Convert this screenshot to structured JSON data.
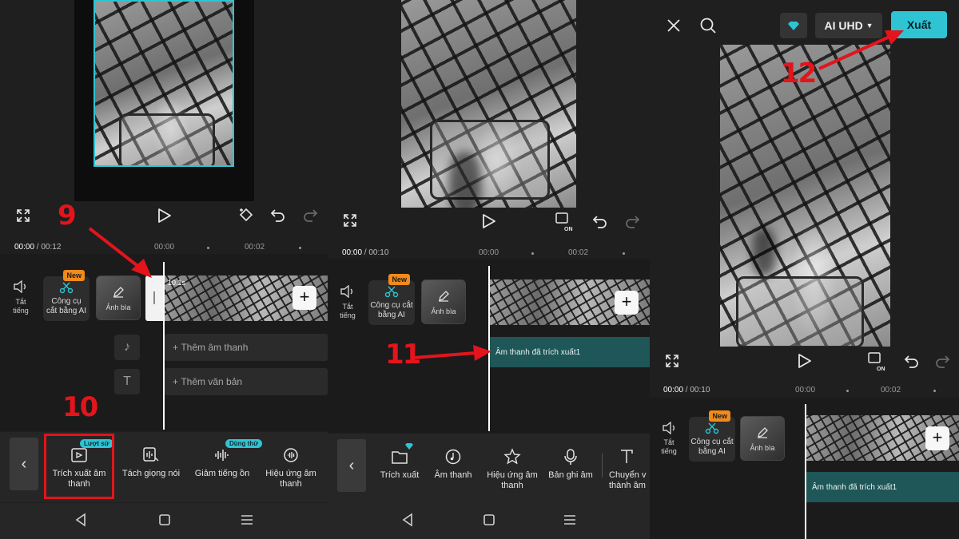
{
  "steps": {
    "s9": "9",
    "s10": "10",
    "s11": "11",
    "s12": "12"
  },
  "panel1": {
    "time_current": "00:00",
    "time_total": " / 00:12",
    "ticks": [
      "00:00",
      "00:02"
    ],
    "mute_label_1": "Tắt",
    "mute_label_2": "tiếng",
    "ai_tool_badge": "New",
    "ai_tool_label_1": "Công cụ",
    "ai_tool_label_2": "cắt bằng AI",
    "cover_label": "Ảnh bìa",
    "clip_duration": "10.1s",
    "add_audio": "Thêm âm thanh",
    "add_text": "Thêm văn bản",
    "tools": [
      {
        "label_1": "Trích xuất âm",
        "label_2": "thanh",
        "badge": "Lượt sử"
      },
      {
        "label_1": "Tách giọng nói",
        "label_2": ""
      },
      {
        "label_1": "Giảm tiếng ồn",
        "label_2": "",
        "badge": "Dùng thử"
      },
      {
        "label_1": "Hiệu ứng âm",
        "label_2": "thanh"
      }
    ]
  },
  "panel2": {
    "time_current": "00:00",
    "time_total": " / 00:10",
    "ticks": [
      "00:00",
      "00:02"
    ],
    "mute_label_1": "Tắt",
    "mute_label_2": "tiếng",
    "ai_tool_badge": "New",
    "ai_tool_label_1": "Công cụ cắt",
    "ai_tool_label_2": "bằng AI",
    "cover_label": "Ảnh bìa",
    "audio_track": "Âm thanh đã trích xuất1",
    "tools": [
      {
        "label_1": "Trích xuất",
        "label_2": ""
      },
      {
        "label_1": "Âm thanh",
        "label_2": ""
      },
      {
        "label_1": "Hiệu ứng âm",
        "label_2": "thanh"
      },
      {
        "label_1": "Bản ghi âm",
        "label_2": ""
      },
      {
        "label_1": "Chuyển v",
        "label_2": "thành âm"
      }
    ]
  },
  "panel3": {
    "resolution": "AI UHD",
    "export": "Xuất",
    "time_current": "00:00",
    "time_total": " / 00:10",
    "ticks": [
      "00:00",
      "00:02"
    ],
    "mute_label_1": "Tắt",
    "mute_label_2": "tiếng",
    "ai_tool_badge": "New",
    "ai_tool_label_1": "Công cụ cắt",
    "ai_tool_label_2": "bằng AI",
    "cover_label": "Ảnh bìa",
    "audio_track": "Âm thanh đã trích xuất1"
  },
  "colors": {
    "accent": "#2ec4d4",
    "annotation": "#e3141b",
    "badge_new": "#f08b1b",
    "audio_track": "#1f5657"
  }
}
